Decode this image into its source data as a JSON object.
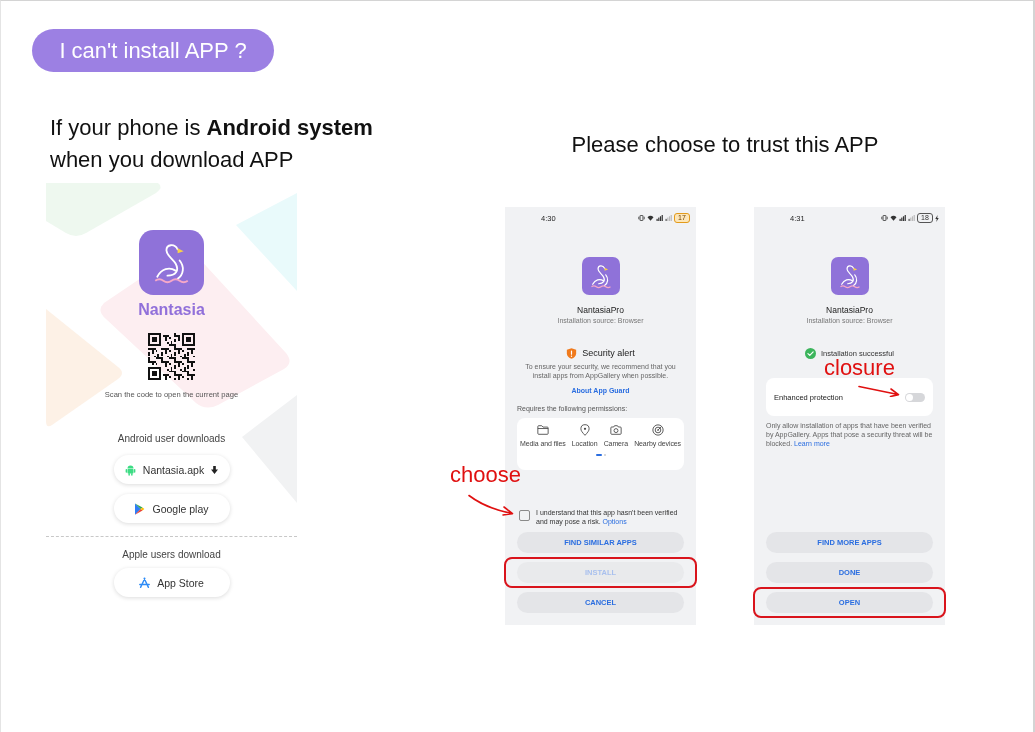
{
  "help_badge": {
    "text": "I can't install APP ?"
  },
  "android_guide": {
    "heading": "If your phone is **Android system** when you download APP",
    "download_page": {
      "app_name": "Nantasia",
      "qr_caption": "Scan the code to open the current page",
      "groups": [
        {
          "title": "Android user downloads",
          "buttons": [
            {
              "kind": "apk",
              "label": "Nantasia.apk"
            },
            {
              "kind": "google_play",
              "label": "Google play"
            }
          ]
        },
        {
          "title": "Apple users download",
          "buttons": [
            {
              "kind": "app_store",
              "label": "App Store"
            }
          ]
        }
      ]
    }
  },
  "trust_guide": {
    "heading": "Please choose to trust this APP",
    "phones": [
      {
        "status_bar": {
          "time": "4:30",
          "battery": "17",
          "battery_low": true,
          "charging": false
        },
        "app_name": "NantasiaPro",
        "source": "Installation source: Browser",
        "status": {
          "kind": "alert",
          "text": "Security alert"
        },
        "message": "To ensure your security, we recommend that you install apps from AppGallery when possible.",
        "link": "About App Guard",
        "permissions": {
          "title": "Requires the following permissions:",
          "items": [
            {
              "kind": "folder",
              "label": "Media and files"
            },
            {
              "kind": "location",
              "label": "Location"
            },
            {
              "kind": "camera",
              "label": "Camera"
            },
            {
              "kind": "nearby",
              "label": "Nearby devices"
            }
          ],
          "pager": [
            {
              "selected": true
            },
            {
              "selected": false
            }
          ]
        },
        "consent": {
          "text": "I understand that this app hasn't been verified and may pose a risk.",
          "link": "Options",
          "checked": false,
          "callout": "choose"
        },
        "buttons": [
          {
            "label": "FIND SIMILAR APPS",
            "disabled": false,
            "highlighted": false
          },
          {
            "label": "INSTALL",
            "disabled": true,
            "highlighted": true
          },
          {
            "label": "CANCEL",
            "disabled": false,
            "highlighted": false
          }
        ]
      },
      {
        "status_bar": {
          "time": "4:31",
          "battery": "18",
          "battery_low": false,
          "charging": true
        },
        "app_name": "NantasiaPro",
        "source": "Installation source: Browser",
        "status": {
          "kind": "success",
          "text": "Installation successful"
        },
        "setting": {
          "label": "Enhanced protection",
          "on": false,
          "callout": "closure"
        },
        "note": {
          "text": "Only allow installation of apps that have been verified by AppGallery. Apps that pose a security threat will be blocked.",
          "link": "Learn more"
        },
        "buttons": [
          {
            "label": "FIND MORE APPS",
            "disabled": false,
            "highlighted": false
          },
          {
            "label": "DONE",
            "disabled": false,
            "highlighted": false
          },
          {
            "label": "OPEN",
            "disabled": false,
            "highlighted": true
          }
        ]
      }
    ]
  }
}
